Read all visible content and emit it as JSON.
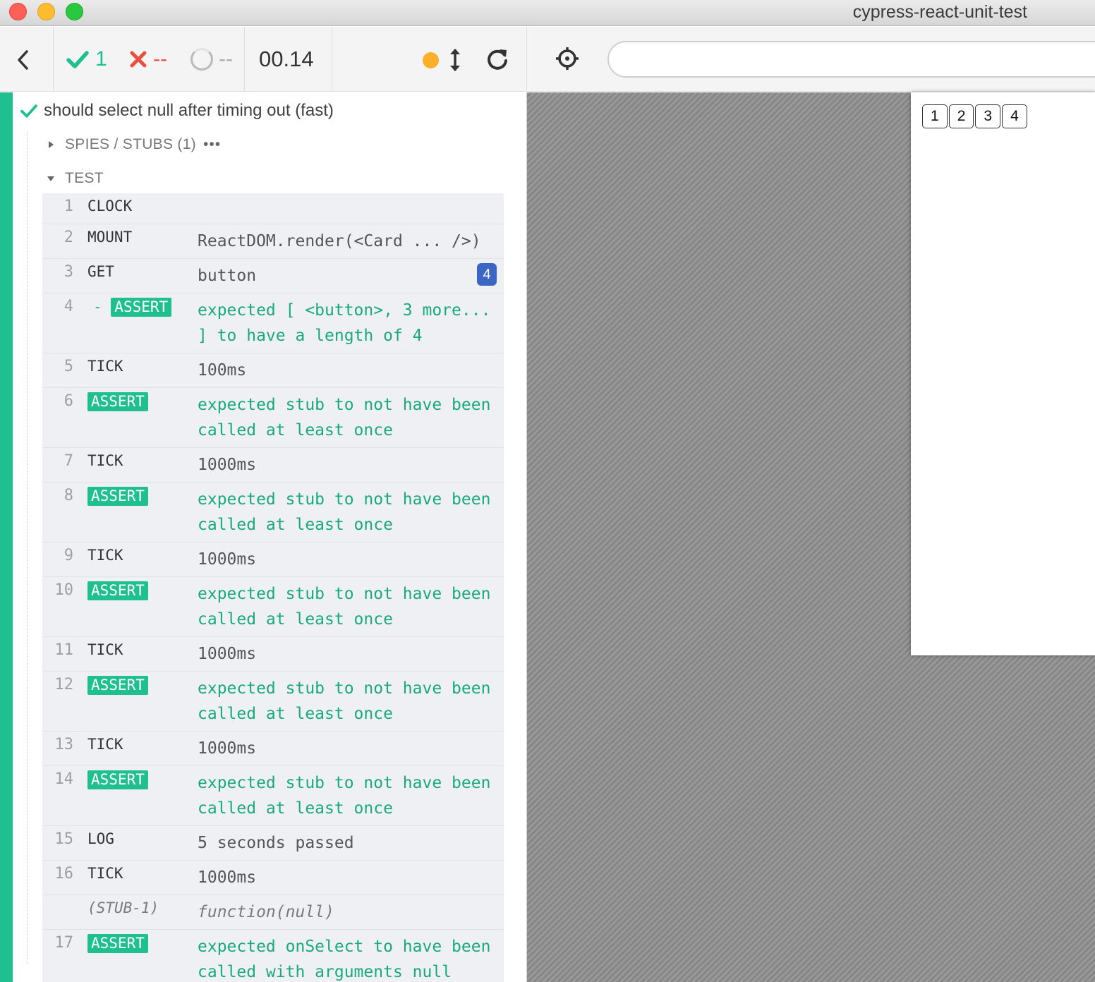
{
  "window": {
    "title": "cypress-react-unit-test"
  },
  "header": {
    "passed": "1",
    "failed": "--",
    "pending": "--",
    "duration": "00.14"
  },
  "runner": {
    "url_value": ""
  },
  "aut": {
    "buttons": [
      "1",
      "2",
      "3",
      "4"
    ]
  },
  "test": {
    "title": "should select null after timing out (fast)",
    "spies_label": "SPIES / STUBS (1)",
    "spies_more": "•••",
    "section_label": "TEST"
  },
  "commands": [
    {
      "num": "1",
      "name": "CLOCK",
      "msg": "",
      "type": "normal"
    },
    {
      "num": "2",
      "name": "MOUNT",
      "msg": "ReactDOM.render(<Card ... />)",
      "type": "normal"
    },
    {
      "num": "3",
      "name": "GET",
      "msg": "button",
      "type": "normal",
      "count": "4"
    },
    {
      "num": "4",
      "name": "- ASSERT",
      "badge": "ASSERT",
      "msg": "expected [ <button>, 3 more... ] to have a length of 4",
      "type": "assert",
      "child": true
    },
    {
      "num": "5",
      "name": "TICK",
      "msg": "100ms",
      "type": "normal"
    },
    {
      "num": "6",
      "name": "ASSERT",
      "badge": "ASSERT",
      "msg": "expected stub to not have been called at least once",
      "type": "assert"
    },
    {
      "num": "7",
      "name": "TICK",
      "msg": "1000ms",
      "type": "normal"
    },
    {
      "num": "8",
      "name": "ASSERT",
      "badge": "ASSERT",
      "msg": "expected stub to not have been called at least once",
      "type": "assert"
    },
    {
      "num": "9",
      "name": "TICK",
      "msg": "1000ms",
      "type": "normal"
    },
    {
      "num": "10",
      "name": "ASSERT",
      "badge": "ASSERT",
      "msg": "expected stub to not have been called at least once",
      "type": "assert"
    },
    {
      "num": "11",
      "name": "TICK",
      "msg": "1000ms",
      "type": "normal"
    },
    {
      "num": "12",
      "name": "ASSERT",
      "badge": "ASSERT",
      "msg": "expected stub to not have been called at least once",
      "type": "assert"
    },
    {
      "num": "13",
      "name": "TICK",
      "msg": "1000ms",
      "type": "normal"
    },
    {
      "num": "14",
      "name": "ASSERT",
      "badge": "ASSERT",
      "msg": "expected stub to not have been called at least once",
      "type": "assert"
    },
    {
      "num": "15",
      "name": "LOG",
      "msg": "5 seconds passed",
      "type": "normal"
    },
    {
      "num": "16",
      "name": "TICK",
      "msg": "1000ms",
      "type": "normal"
    },
    {
      "num": "",
      "name": "(STUB-1)",
      "msg": "function(null)",
      "type": "stub"
    },
    {
      "num": "17",
      "name": "ASSERT",
      "badge": "ASSERT",
      "msg": "expected onSelect to have been called with arguments null",
      "type": "assert"
    }
  ],
  "colors": {
    "pass": "#1fbf8f",
    "fail": "#e94f3e",
    "running_dot": "#fbaf2b",
    "count_badge": "#3d66c4"
  }
}
